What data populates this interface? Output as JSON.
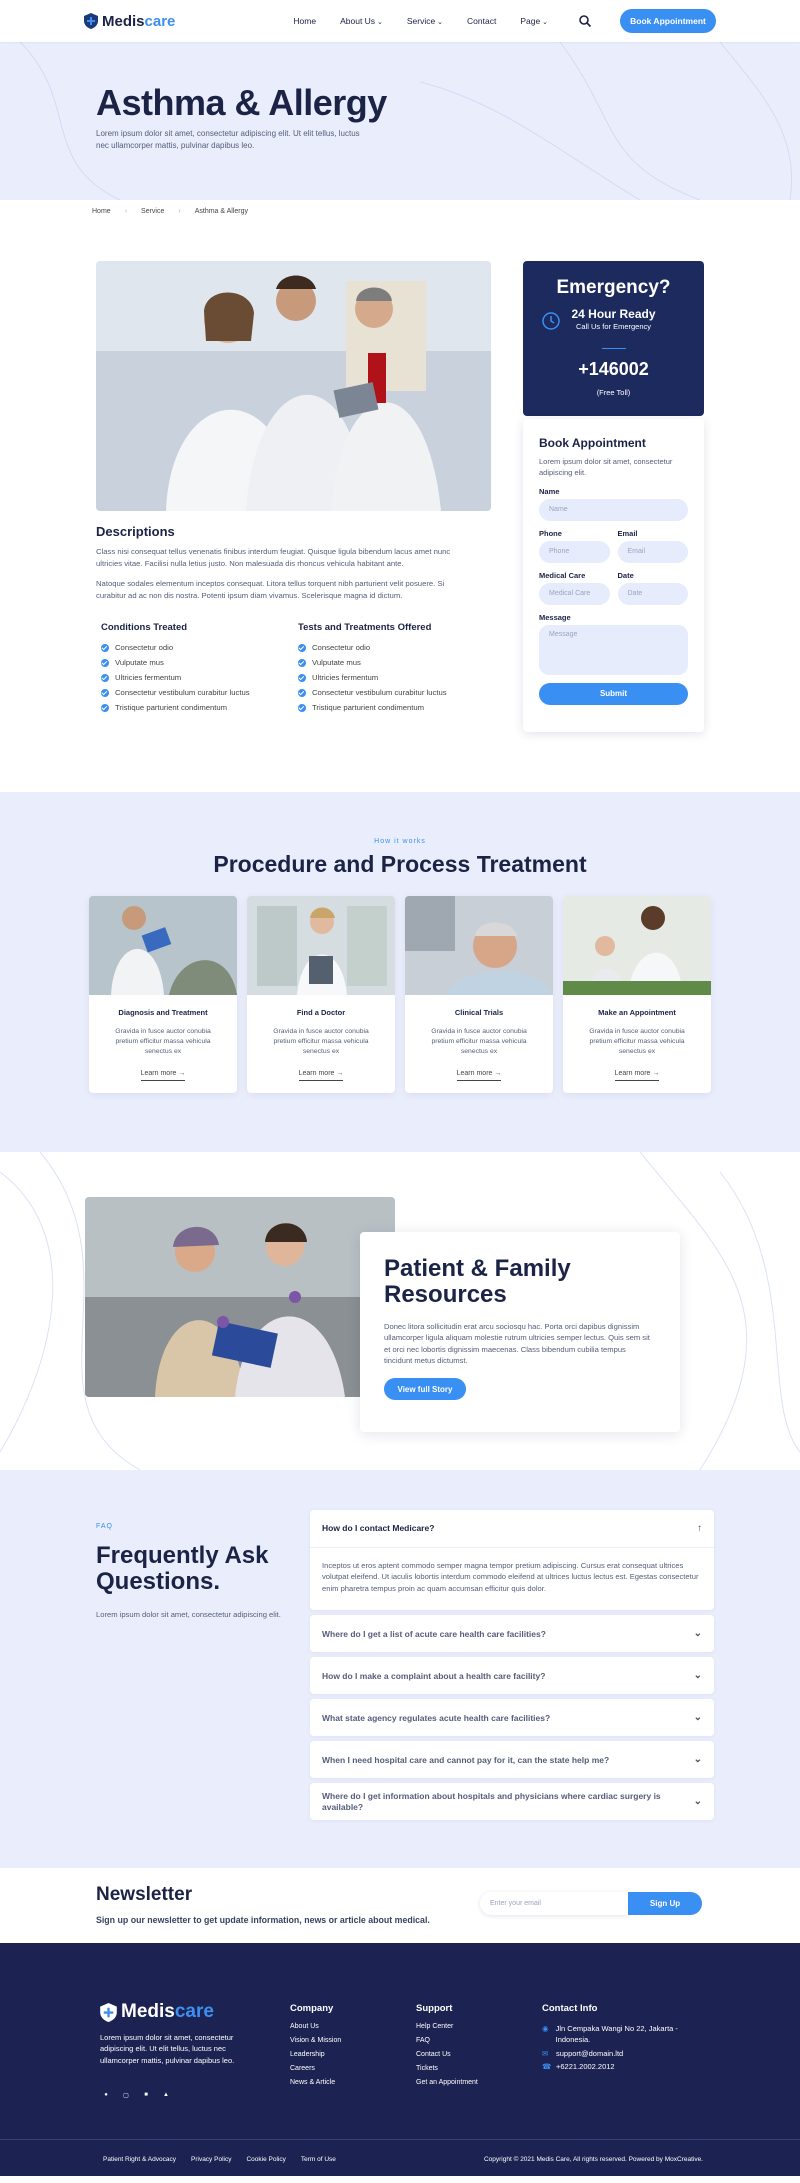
{
  "header": {
    "logo_a": "Medis",
    "logo_b": "care",
    "nav": [
      "Home",
      "About Us",
      "Service",
      "Contact",
      "Page"
    ],
    "cta": "Book Appointment"
  },
  "hero": {
    "title": "Asthma & Allergy",
    "subtitle": "Lorem ipsum dolor sit amet, consectetur adipiscing elit. Ut elit tellus, luctus nec ullamcorper mattis, pulvinar dapibus leo."
  },
  "breadcrumb": [
    "Home",
    "Service",
    "Asthma & Allergy"
  ],
  "description": {
    "title": "Descriptions",
    "p1": "Class nisi consequat tellus venenatis finibus interdum feugiat. Quisque ligula bibendum lacus amet nunc ultricies vitae. Facilisi nulla letius justo. Non malesuada dis rhoncus vehicula habitant ante.",
    "p2": "Natoque sodales elementum inceptos consequat. Litora tellus torquent nibh parturient velit posuere. Si curabitur ad ac non dis nostra. Potenti ipsum diam vivamus. Scelerisque magna id dictum."
  },
  "conditions": {
    "title": "Conditions Treated",
    "items": [
      "Consectetur odio",
      "Vulputate mus",
      "Ultricies fermentum",
      "Consectetur vestibulum curabitur luctus",
      "Tristique parturient condimentum"
    ]
  },
  "tests": {
    "title": "Tests and Treatments Offered",
    "items": [
      "Consectetur odio",
      "Vulputate mus",
      "Ultricies fermentum",
      "Consectetur vestibulum curabitur luctus",
      "Tristique parturient condimentum"
    ]
  },
  "emergency": {
    "title": "Emergency?",
    "line1": "24 Hour Ready",
    "line2": "Call Us for Emergency",
    "phone": "+146002",
    "note": "(Free Toll)"
  },
  "form": {
    "title": "Book Appointment",
    "desc": "Lorem ipsum dolor sit amet, consectetur adipiscing elit.",
    "name_label": "Name",
    "name_ph": "Name",
    "phone_label": "Phone",
    "phone_ph": "Phone",
    "email_label": "Email",
    "email_ph": "Email",
    "care_label": "Medical Care",
    "care_ph": "Medical Care",
    "date_label": "Date",
    "date_ph": "Date",
    "msg_label": "Message",
    "msg_ph": "Message",
    "submit": "Submit"
  },
  "procedure": {
    "tag": "How it works",
    "title": "Procedure and Process Treatment",
    "cards": [
      {
        "title": "Diagnosis and Treatment",
        "text": "Gravida in fusce auctor conubia pretium efficitur massa vehicula senectus ex",
        "link": "Learn more →"
      },
      {
        "title": "Find a Doctor",
        "text": "Gravida in fusce auctor conubia pretium efficitur massa vehicula senectus ex",
        "link": "Learn more →"
      },
      {
        "title": "Clinical Trials",
        "text": "Gravida in fusce auctor conubia pretium efficitur massa vehicula senectus ex",
        "link": "Learn more →"
      },
      {
        "title": "Make an Appointment",
        "text": "Gravida in fusce auctor conubia pretium efficitur massa vehicula senectus ex",
        "link": "Learn more →"
      }
    ]
  },
  "patient": {
    "title": "Patient & Family Resources",
    "text": "Donec litora sollicitudin erat arcu sociosqu hac. Porta orci dapibus dignissim ullamcorper ligula aliquam molestie rutrum ultricies semper lectus. Quis sem sit et orci nec lobortis dignissim maecenas. Class bibendum cubilia tempus tincidunt metus dictumst.",
    "cta": "View full Story"
  },
  "faq": {
    "tag": "FAQ",
    "title": "Frequently Ask Questions.",
    "desc": "Lorem ipsum dolor sit amet, consectetur adipiscing elit.",
    "open_q": "How do I contact Medicare?",
    "open_a": "Inceptos ut eros aptent commodo semper magna tempor pretium adipiscing. Cursus erat consequat ultrices volutpat eleifend. Ut iaculis lobortis interdum commodo eleifend at ultrices luctus lectus est. Egestas consectetur enim pharetra tempus proin ac quam accumsan efficitur quis dolor.",
    "questions": [
      "Where do I get a list of acute care health care facilities?",
      "How do I make a complaint about a health care facility?",
      "What state agency regulates acute health care facilities?",
      "When I need hospital care and cannot pay for it, can the state help me?",
      "Where do I get information about hospitals and physicians where cardiac surgery is available?"
    ]
  },
  "newsletter": {
    "title": "Newsletter",
    "desc": "Sign up our newsletter to get update information, news or article about medical.",
    "placeholder": "Enter your email",
    "cta": "Sign Up"
  },
  "footer": {
    "desc": "Lorem ipsum dolor sit amet, consectetur adipiscing elit. Ut elit tellus, luctus nec ullamcorper mattis, pulvinar dapibus leo.",
    "company_title": "Company",
    "company": [
      "About Us",
      "Vision & Mission",
      "Leadership",
      "Careers",
      "News & Article"
    ],
    "support_title": "Support",
    "support": [
      "Help Center",
      "FAQ",
      "Contact Us",
      "Tickets",
      "Get an Appointment"
    ],
    "contact_title": "Contact Info",
    "address": "Jln Cempaka Wangi No 22, Jakarta - Indonesia.",
    "email": "support@domain.ltd",
    "phone": "+6221.2002.2012",
    "bottom_links": [
      "Patient Right & Advocacy",
      "Privacy Policy",
      "Cookie Policy",
      "Term of Use"
    ],
    "copyright": "Copyright © 2021 Medis Care, All rights reserved. Powered by MoxCreative."
  },
  "colors": {
    "accent": "#3a8ff3",
    "navy": "#1c2352",
    "light": "#eaeefc"
  }
}
